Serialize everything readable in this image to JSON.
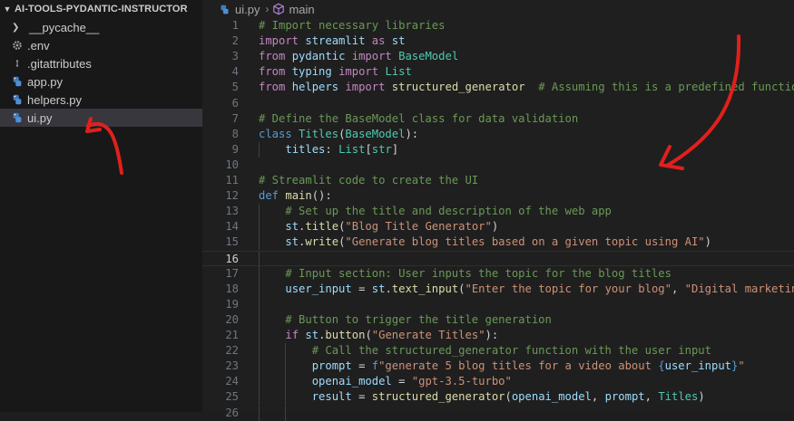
{
  "sidebar": {
    "header": "AI-TOOLS-PYDANTIC-INSTRUCTOR",
    "items": [
      {
        "label": "__pycache__",
        "kind": "folder",
        "icon": "chevron-right-icon"
      },
      {
        "label": ".env",
        "kind": "file",
        "icon": "gear-icon"
      },
      {
        "label": ".gitattributes",
        "kind": "file",
        "icon": "git-file-icon"
      },
      {
        "label": "app.py",
        "kind": "file",
        "icon": "python-icon"
      },
      {
        "label": "helpers.py",
        "kind": "file",
        "icon": "python-icon"
      },
      {
        "label": "ui.py",
        "kind": "file",
        "icon": "python-icon",
        "selected": true
      }
    ]
  },
  "breadcrumb": {
    "file": "ui.py",
    "symbol": "main",
    "file_icon": "python-icon",
    "symbol_icon": "cube-icon"
  },
  "editor": {
    "current_line": 16,
    "lines": [
      {
        "n": "1",
        "tokens": [
          [
            "cmt",
            "# Import necessary libraries"
          ]
        ]
      },
      {
        "n": "2",
        "tokens": [
          [
            "kw",
            "import"
          ],
          [
            "pl",
            " "
          ],
          [
            "var",
            "streamlit"
          ],
          [
            "pl",
            " "
          ],
          [
            "kw",
            "as"
          ],
          [
            "pl",
            " "
          ],
          [
            "var",
            "st"
          ]
        ]
      },
      {
        "n": "3",
        "tokens": [
          [
            "kw",
            "from"
          ],
          [
            "pl",
            " "
          ],
          [
            "var",
            "pydantic"
          ],
          [
            "pl",
            " "
          ],
          [
            "kw",
            "import"
          ],
          [
            "pl",
            " "
          ],
          [
            "cls",
            "BaseModel"
          ]
        ]
      },
      {
        "n": "4",
        "tokens": [
          [
            "kw",
            "from"
          ],
          [
            "pl",
            " "
          ],
          [
            "var",
            "typing"
          ],
          [
            "pl",
            " "
          ],
          [
            "kw",
            "import"
          ],
          [
            "pl",
            " "
          ],
          [
            "cls",
            "List"
          ]
        ]
      },
      {
        "n": "5",
        "tokens": [
          [
            "kw",
            "from"
          ],
          [
            "pl",
            " "
          ],
          [
            "var",
            "helpers"
          ],
          [
            "pl",
            " "
          ],
          [
            "kw",
            "import"
          ],
          [
            "pl",
            " "
          ],
          [
            "fn",
            "structured_generator"
          ],
          [
            "pl",
            "  "
          ],
          [
            "cmt",
            "# Assuming this is a predefined function in"
          ]
        ]
      },
      {
        "n": "6",
        "tokens": []
      },
      {
        "n": "7",
        "tokens": [
          [
            "cmt",
            "# Define the BaseModel class for data validation"
          ]
        ]
      },
      {
        "n": "8",
        "tokens": [
          [
            "def",
            "class"
          ],
          [
            "pl",
            " "
          ],
          [
            "cls",
            "Titles"
          ],
          [
            "pl",
            "("
          ],
          [
            "cls",
            "BaseModel"
          ],
          [
            "pl",
            "):"
          ]
        ]
      },
      {
        "n": "9",
        "indent": 1,
        "tokens": [
          [
            "pl",
            "    "
          ],
          [
            "var",
            "titles"
          ],
          [
            "pl",
            ": "
          ],
          [
            "cls",
            "List"
          ],
          [
            "pl",
            "["
          ],
          [
            "cls",
            "str"
          ],
          [
            "pl",
            "]"
          ]
        ]
      },
      {
        "n": "10",
        "tokens": []
      },
      {
        "n": "11",
        "tokens": [
          [
            "cmt",
            "# Streamlit code to create the UI"
          ]
        ]
      },
      {
        "n": "12",
        "tokens": [
          [
            "def",
            "def"
          ],
          [
            "pl",
            " "
          ],
          [
            "fn",
            "main"
          ],
          [
            "pl",
            "():"
          ]
        ]
      },
      {
        "n": "13",
        "indent": 1,
        "tokens": [
          [
            "pl",
            "    "
          ],
          [
            "cmt",
            "# Set up the title and description of the web app"
          ]
        ]
      },
      {
        "n": "14",
        "indent": 1,
        "tokens": [
          [
            "pl",
            "    "
          ],
          [
            "var",
            "st"
          ],
          [
            "pl",
            "."
          ],
          [
            "fn",
            "title"
          ],
          [
            "pl",
            "("
          ],
          [
            "str",
            "\"Blog Title Generator\""
          ],
          [
            "pl",
            ")"
          ]
        ]
      },
      {
        "n": "15",
        "indent": 1,
        "tokens": [
          [
            "pl",
            "    "
          ],
          [
            "var",
            "st"
          ],
          [
            "pl",
            "."
          ],
          [
            "fn",
            "write"
          ],
          [
            "pl",
            "("
          ],
          [
            "str",
            "\"Generate blog titles based on a given topic using AI\""
          ],
          [
            "pl",
            ")"
          ]
        ]
      },
      {
        "n": "16",
        "indent": 1,
        "tokens": []
      },
      {
        "n": "17",
        "indent": 1,
        "tokens": [
          [
            "pl",
            "    "
          ],
          [
            "cmt",
            "# Input section: User inputs the topic for the blog titles"
          ]
        ]
      },
      {
        "n": "18",
        "indent": 1,
        "tokens": [
          [
            "pl",
            "    "
          ],
          [
            "var",
            "user_input"
          ],
          [
            "op",
            " = "
          ],
          [
            "var",
            "st"
          ],
          [
            "pl",
            "."
          ],
          [
            "fn",
            "text_input"
          ],
          [
            "pl",
            "("
          ],
          [
            "str",
            "\"Enter the topic for your blog\""
          ],
          [
            "pl",
            ", "
          ],
          [
            "str",
            "\"Digital marketing\""
          ],
          [
            "pl",
            ")"
          ]
        ]
      },
      {
        "n": "19",
        "indent": 1,
        "tokens": []
      },
      {
        "n": "20",
        "indent": 1,
        "tokens": [
          [
            "pl",
            "    "
          ],
          [
            "cmt",
            "# Button to trigger the title generation"
          ]
        ]
      },
      {
        "n": "21",
        "indent": 1,
        "tokens": [
          [
            "pl",
            "    "
          ],
          [
            "kw",
            "if"
          ],
          [
            "pl",
            " "
          ],
          [
            "var",
            "st"
          ],
          [
            "pl",
            "."
          ],
          [
            "fn",
            "button"
          ],
          [
            "pl",
            "("
          ],
          [
            "str",
            "\"Generate Titles\""
          ],
          [
            "pl",
            "):"
          ]
        ]
      },
      {
        "n": "22",
        "indent": 2,
        "tokens": [
          [
            "pl",
            "        "
          ],
          [
            "cmt",
            "# Call the structured_generator function with the user input"
          ]
        ]
      },
      {
        "n": "23",
        "indent": 2,
        "tokens": [
          [
            "pl",
            "        "
          ],
          [
            "var",
            "prompt"
          ],
          [
            "op",
            " = "
          ],
          [
            "def",
            "f"
          ],
          [
            "str",
            "\"generate 5 blog titles for a video about "
          ],
          [
            "def",
            "{"
          ],
          [
            "var",
            "user_input"
          ],
          [
            "def",
            "}"
          ],
          [
            "str",
            "\""
          ]
        ]
      },
      {
        "n": "24",
        "indent": 2,
        "tokens": [
          [
            "pl",
            "        "
          ],
          [
            "var",
            "openai_model"
          ],
          [
            "op",
            " = "
          ],
          [
            "str",
            "\"gpt-3.5-turbo\""
          ]
        ]
      },
      {
        "n": "25",
        "indent": 2,
        "tokens": [
          [
            "pl",
            "        "
          ],
          [
            "var",
            "result"
          ],
          [
            "op",
            " = "
          ],
          [
            "fn",
            "structured_generator"
          ],
          [
            "pl",
            "("
          ],
          [
            "var",
            "openai_model"
          ],
          [
            "pl",
            ", "
          ],
          [
            "var",
            "prompt"
          ],
          [
            "pl",
            ", "
          ],
          [
            "cls",
            "Titles"
          ],
          [
            "pl",
            ")"
          ]
        ]
      },
      {
        "n": "26",
        "indent": 2,
        "tokens": []
      }
    ]
  },
  "colors": {
    "sidebar_bg": "#181818",
    "editor_bg": "#1f1f1f",
    "selected_row": "#37373d",
    "annotation": "#e0201c"
  }
}
